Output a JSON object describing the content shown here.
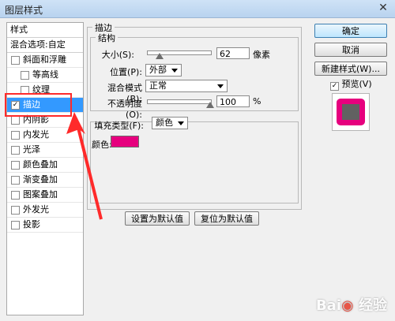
{
  "window": {
    "title": "图层样式"
  },
  "left_panel": {
    "header": "样式",
    "blend": "混合选项:自定",
    "items": [
      {
        "label": "斜面和浮雕",
        "checked": false,
        "sub": false,
        "selected": false
      },
      {
        "label": "等高线",
        "checked": false,
        "sub": true,
        "selected": false
      },
      {
        "label": "纹理",
        "checked": false,
        "sub": true,
        "selected": false
      },
      {
        "label": "描边",
        "checked": true,
        "sub": false,
        "selected": true
      },
      {
        "label": "内阴影",
        "checked": false,
        "sub": false,
        "selected": false
      },
      {
        "label": "内发光",
        "checked": false,
        "sub": false,
        "selected": false
      },
      {
        "label": "光泽",
        "checked": false,
        "sub": false,
        "selected": false
      },
      {
        "label": "颜色叠加",
        "checked": false,
        "sub": false,
        "selected": false
      },
      {
        "label": "渐变叠加",
        "checked": false,
        "sub": false,
        "selected": false
      },
      {
        "label": "图案叠加",
        "checked": false,
        "sub": false,
        "selected": false
      },
      {
        "label": "外发光",
        "checked": false,
        "sub": false,
        "selected": false
      },
      {
        "label": "投影",
        "checked": false,
        "sub": false,
        "selected": false
      }
    ]
  },
  "stroke": {
    "title": "描边",
    "structure": "结构",
    "size_label": "大小(S):",
    "size_value": "62",
    "size_unit": "像素",
    "size_level": 0.2,
    "position_label": "位置(P):",
    "position_value": "外部",
    "blend_label": "混合模式(B):",
    "blend_value": "正常",
    "opacity_label": "不透明度(O):",
    "opacity_value": "100",
    "opacity_unit": "%",
    "opacity_level": 1.0,
    "fill_type_label": "填充类型(F):",
    "fill_type_value": "颜色",
    "color_label": "颜色:",
    "color": "#e6007e",
    "set_default": "设置为默认值",
    "reset_default": "复位为默认值"
  },
  "right": {
    "ok": "确定",
    "cancel": "取消",
    "new_style": "新建样式(W)...",
    "preview_label": "预览(V)",
    "preview_checked": true
  },
  "watermark": "Bai 经验",
  "colors": {
    "selection": "#3399ff",
    "annotation": "#ff2a2a",
    "stroke": "#e6007e"
  }
}
